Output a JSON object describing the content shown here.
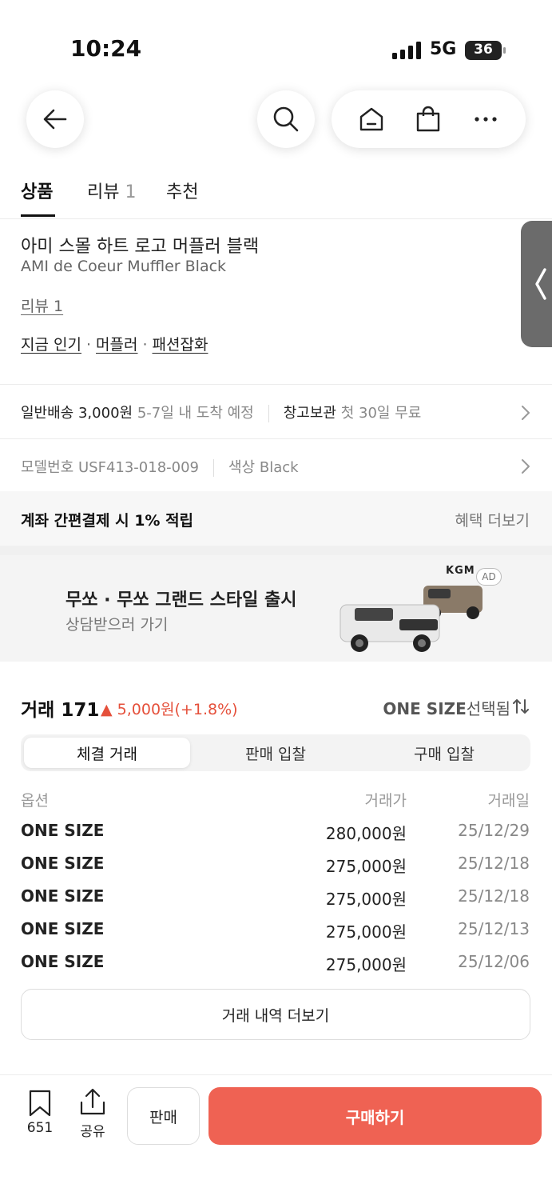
{
  "status": {
    "time": "10:24",
    "network": "5G",
    "battery": "36"
  },
  "tabs": [
    {
      "label": "상품"
    },
    {
      "label": "리뷰",
      "count": "1"
    },
    {
      "label": "추천"
    }
  ],
  "product": {
    "name_ko": "아미 스몰 하트 로고 머플러 블랙",
    "name_en": "AMI de Coeur Muffler Black",
    "review_link": "리뷰 1",
    "categories": [
      "지금 인기",
      "머플러",
      "패션잡화"
    ]
  },
  "shipping": {
    "label": "일반배송",
    "fee": "3,000원",
    "eta": "5-7일 내 도착 예정",
    "storage_label": "창고보관",
    "storage_note": "첫 30일 무료"
  },
  "model": {
    "model_label": "모델번호",
    "model_no": "USF413-018-009",
    "color_label": "색상",
    "color": "Black"
  },
  "benefit": {
    "text": "계좌 간편결제 시 1% 적립",
    "more": "혜택 더보기"
  },
  "ad": {
    "title": "무쏘 · 무쏘 그랜드 스타일 출시",
    "subtitle": "상담받으러 가기",
    "brand": "KGM",
    "badge": "AD"
  },
  "trades": {
    "title": "거래 171",
    "change": "▲ 5,000원(+1.8%)",
    "size": "ONE SIZE",
    "size_suffix": "선택됨",
    "segments": [
      "체결 거래",
      "판매 입찰",
      "구매 입찰"
    ],
    "headers": {
      "option": "옵션",
      "price": "거래가",
      "date": "거래일"
    },
    "rows": [
      {
        "option": "ONE SIZE",
        "price": "280,000원",
        "date": "25/12/29"
      },
      {
        "option": "ONE SIZE",
        "price": "275,000원",
        "date": "25/12/18"
      },
      {
        "option": "ONE SIZE",
        "price": "275,000원",
        "date": "25/12/18"
      },
      {
        "option": "ONE SIZE",
        "price": "275,000원",
        "date": "25/12/13"
      },
      {
        "option": "ONE SIZE",
        "price": "275,000원",
        "date": "25/12/06"
      }
    ],
    "more": "거래 내역 더보기"
  },
  "bottom": {
    "bookmark_count": "651",
    "share_label": "공유",
    "sell_label": "판매",
    "buy_label": "구매하기"
  },
  "colors": {
    "accent": "#ef6253",
    "up": "#e5503b"
  }
}
